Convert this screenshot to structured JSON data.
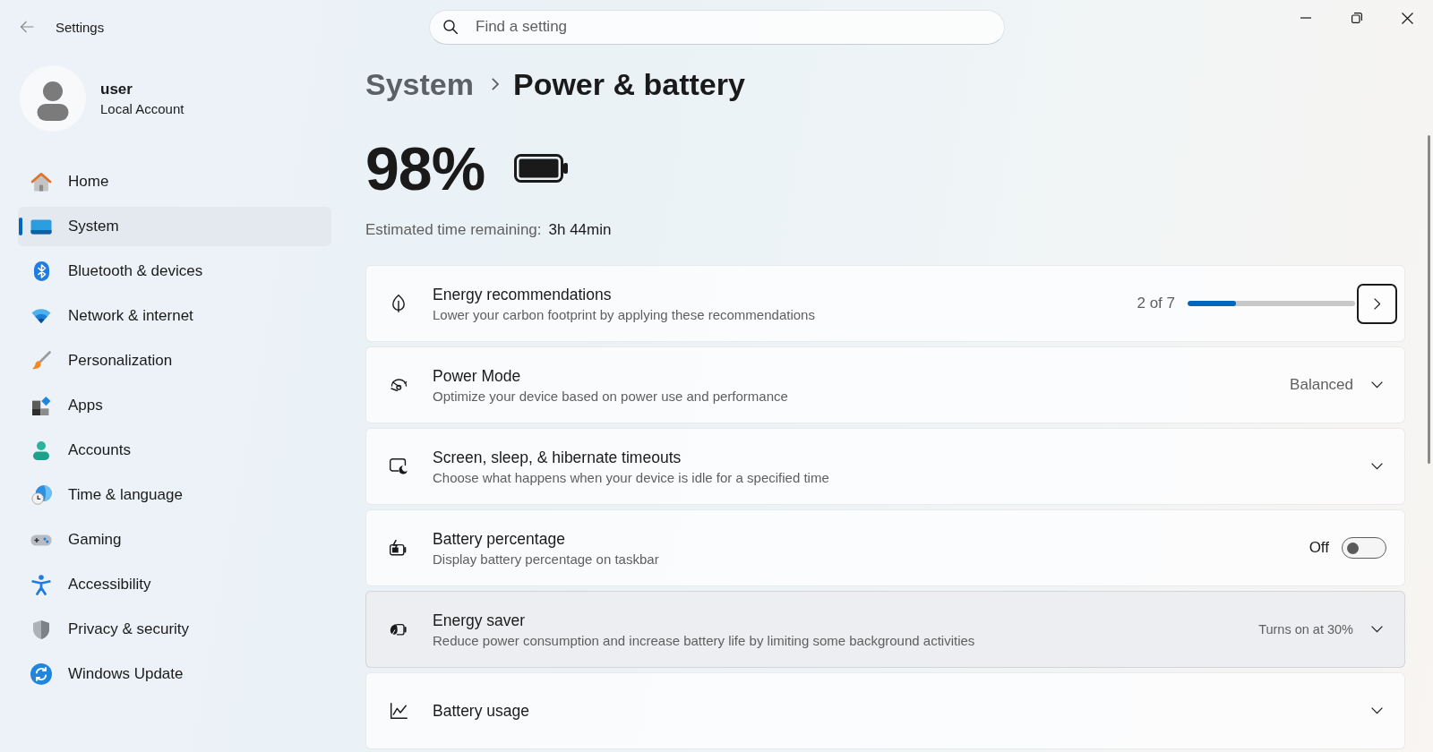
{
  "window": {
    "title": "Settings"
  },
  "search": {
    "placeholder": "Find a setting"
  },
  "account": {
    "name": "user",
    "type": "Local Account"
  },
  "nav": [
    {
      "label": "Home",
      "selected": false
    },
    {
      "label": "System",
      "selected": true
    },
    {
      "label": "Bluetooth & devices",
      "selected": false
    },
    {
      "label": "Network & internet",
      "selected": false
    },
    {
      "label": "Personalization",
      "selected": false
    },
    {
      "label": "Apps",
      "selected": false
    },
    {
      "label": "Accounts",
      "selected": false
    },
    {
      "label": "Time & language",
      "selected": false
    },
    {
      "label": "Gaming",
      "selected": false
    },
    {
      "label": "Accessibility",
      "selected": false
    },
    {
      "label": "Privacy & security",
      "selected": false
    },
    {
      "label": "Windows Update",
      "selected": false
    }
  ],
  "breadcrumb": {
    "parent": "System",
    "current": "Power & battery"
  },
  "battery": {
    "percent": "98%"
  },
  "estimate": {
    "label": "Estimated time remaining:",
    "value": "3h 44min"
  },
  "cards": [
    {
      "kind": "progress",
      "title": "Energy recommendations",
      "subtitle": "Lower your carbon footprint by applying these recommendations",
      "count": "2 of 7",
      "level": 0.29,
      "hovered": false
    },
    {
      "kind": "dropdown",
      "title": "Power Mode",
      "subtitle": "Optimize your device based on power use and performance",
      "value": "Balanced",
      "hovered": false
    },
    {
      "kind": "expander",
      "title": "Screen, sleep, & hibernate timeouts",
      "subtitle": "Choose what happens when your device is idle for a specified time",
      "hovered": false
    },
    {
      "kind": "toggle",
      "title": "Battery percentage",
      "subtitle": "Display battery percentage on taskbar",
      "state_label": "Off",
      "on": false,
      "hovered": false
    },
    {
      "kind": "expander",
      "title": "Energy saver",
      "subtitle": "Reduce power consumption and increase battery life by limiting some background activities",
      "value": "Turns on at 30%",
      "hovered": true
    },
    {
      "kind": "expander",
      "title": "Battery usage",
      "hovered": false
    }
  ]
}
